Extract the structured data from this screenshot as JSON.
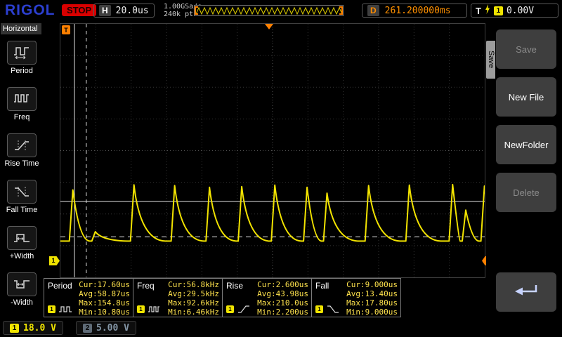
{
  "topbar": {
    "brand": "RIGOL",
    "run_status": "STOP",
    "h_label": "H",
    "timebase": "20.0us",
    "sample_rate": "1.00GSa/s",
    "mem_depth": "240k pts",
    "d_label": "D",
    "d_value": "261.200000ms",
    "t_label": "T",
    "t_source": "1",
    "t_level": "0.00V"
  },
  "left_menu": {
    "title": "Horizontal",
    "items": [
      {
        "label": "Period",
        "icon": "period-icon"
      },
      {
        "label": "Freq",
        "icon": "freq-icon"
      },
      {
        "label": "Rise Time",
        "icon": "rise-time-icon"
      },
      {
        "label": "Fall Time",
        "icon": "fall-time-icon"
      },
      {
        "label": "+Width",
        "icon": "plus-width-icon"
      },
      {
        "label": "-Width",
        "icon": "minus-width-icon"
      }
    ]
  },
  "right_menu": {
    "tab": "Save",
    "buttons": [
      {
        "label": "Save",
        "enabled": false
      },
      {
        "label": "New File",
        "enabled": true
      },
      {
        "label": "NewFolder",
        "enabled": true
      },
      {
        "label": "Delete",
        "enabled": false
      }
    ],
    "back_button_icon": "return-arrow-icon"
  },
  "measurements": [
    {
      "name": "Period",
      "source": "1",
      "cur": "Cur:17.60us",
      "avg": "Avg:58.87us",
      "max": "Max:154.8us",
      "min": "Min:10.80us"
    },
    {
      "name": "Freq",
      "source": "1",
      "cur": "Cur:56.8kHz",
      "avg": "Avg:29.5kHz",
      "max": "Max:92.6kHz",
      "min": "Min:6.46kHz"
    },
    {
      "name": "Rise",
      "source": "1",
      "cur": "Cur:2.600us",
      "avg": "Avg:43.98us",
      "max": "Max:210.0us",
      "min": "Min:2.200us"
    },
    {
      "name": "Fall",
      "source": "1",
      "cur": "Cur:9.000us",
      "avg": "Avg:13.40us",
      "max": "Max:17.80us",
      "min": "Min:9.000us"
    }
  ],
  "channels": {
    "ch1": {
      "num": "1",
      "scale": "18.0 V",
      "color": "#f0e400"
    },
    "ch2": {
      "num": "2",
      "scale": "5.00 V",
      "color": "#8496a6"
    }
  },
  "markers": {
    "trigger_time_label": "T",
    "trigger_level_label": "T",
    "ch1_ground_label": "1"
  },
  "status_icons": [
    "usb-icon",
    "speaker-icon"
  ],
  "waveform": {
    "color": "#f2e300",
    "baseline": 0.857,
    "decay_width": 0.0743,
    "trigger_x": 0.492,
    "marker_y": 0.939,
    "cursors": {
      "h_solid": 0.7,
      "h_dashed": 0.84,
      "v_solid": 0.033,
      "v_dashed": 0.061
    },
    "peaks": [
      {
        "x": 0.021,
        "top": 0.655
      },
      {
        "x": 0.074,
        "top": 0.82
      },
      {
        "x": 0.165,
        "top": 0.635
      },
      {
        "x": 0.261,
        "top": 0.638
      },
      {
        "x": 0.343,
        "top": 0.645
      },
      {
        "x": 0.419,
        "top": 0.642
      },
      {
        "x": 0.497,
        "top": 0.636
      },
      {
        "x": 0.573,
        "top": 0.645
      },
      {
        "x": 0.62,
        "top": 0.668
      },
      {
        "x": 0.718,
        "top": 0.638
      },
      {
        "x": 0.814,
        "top": 0.636
      },
      {
        "x": 0.916,
        "top": 0.634
      },
      {
        "x": 0.947,
        "top": 0.735
      },
      {
        "x": 0.991,
        "top": 0.64
      }
    ]
  }
}
